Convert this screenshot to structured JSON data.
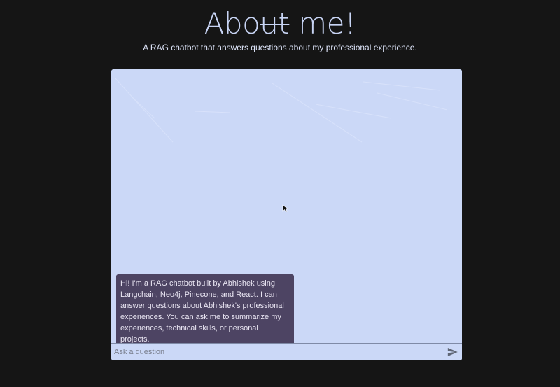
{
  "header": {
    "title_prefix": "Abo",
    "title_strike": "ut",
    "title_suffix": " me!",
    "subtitle": "A RAG chatbot that answers questions about my professional experience."
  },
  "chat": {
    "messages": [
      {
        "role": "bot",
        "text": "Hi! I'm a RAG chatbot built by Abhishek using Langchain, Neo4j, Pinecone, and React. I can answer questions about Abhishek's professional experiences. You can ask me to summarize my experiences, technical skills, or personal projects."
      }
    ],
    "input": {
      "placeholder": "Ask a question",
      "value": ""
    },
    "send_icon": "send-icon"
  },
  "colors": {
    "background": "#151515",
    "panel": "#cbd8f7",
    "bubble": "#4d4463",
    "title": "#c8d4f4"
  }
}
